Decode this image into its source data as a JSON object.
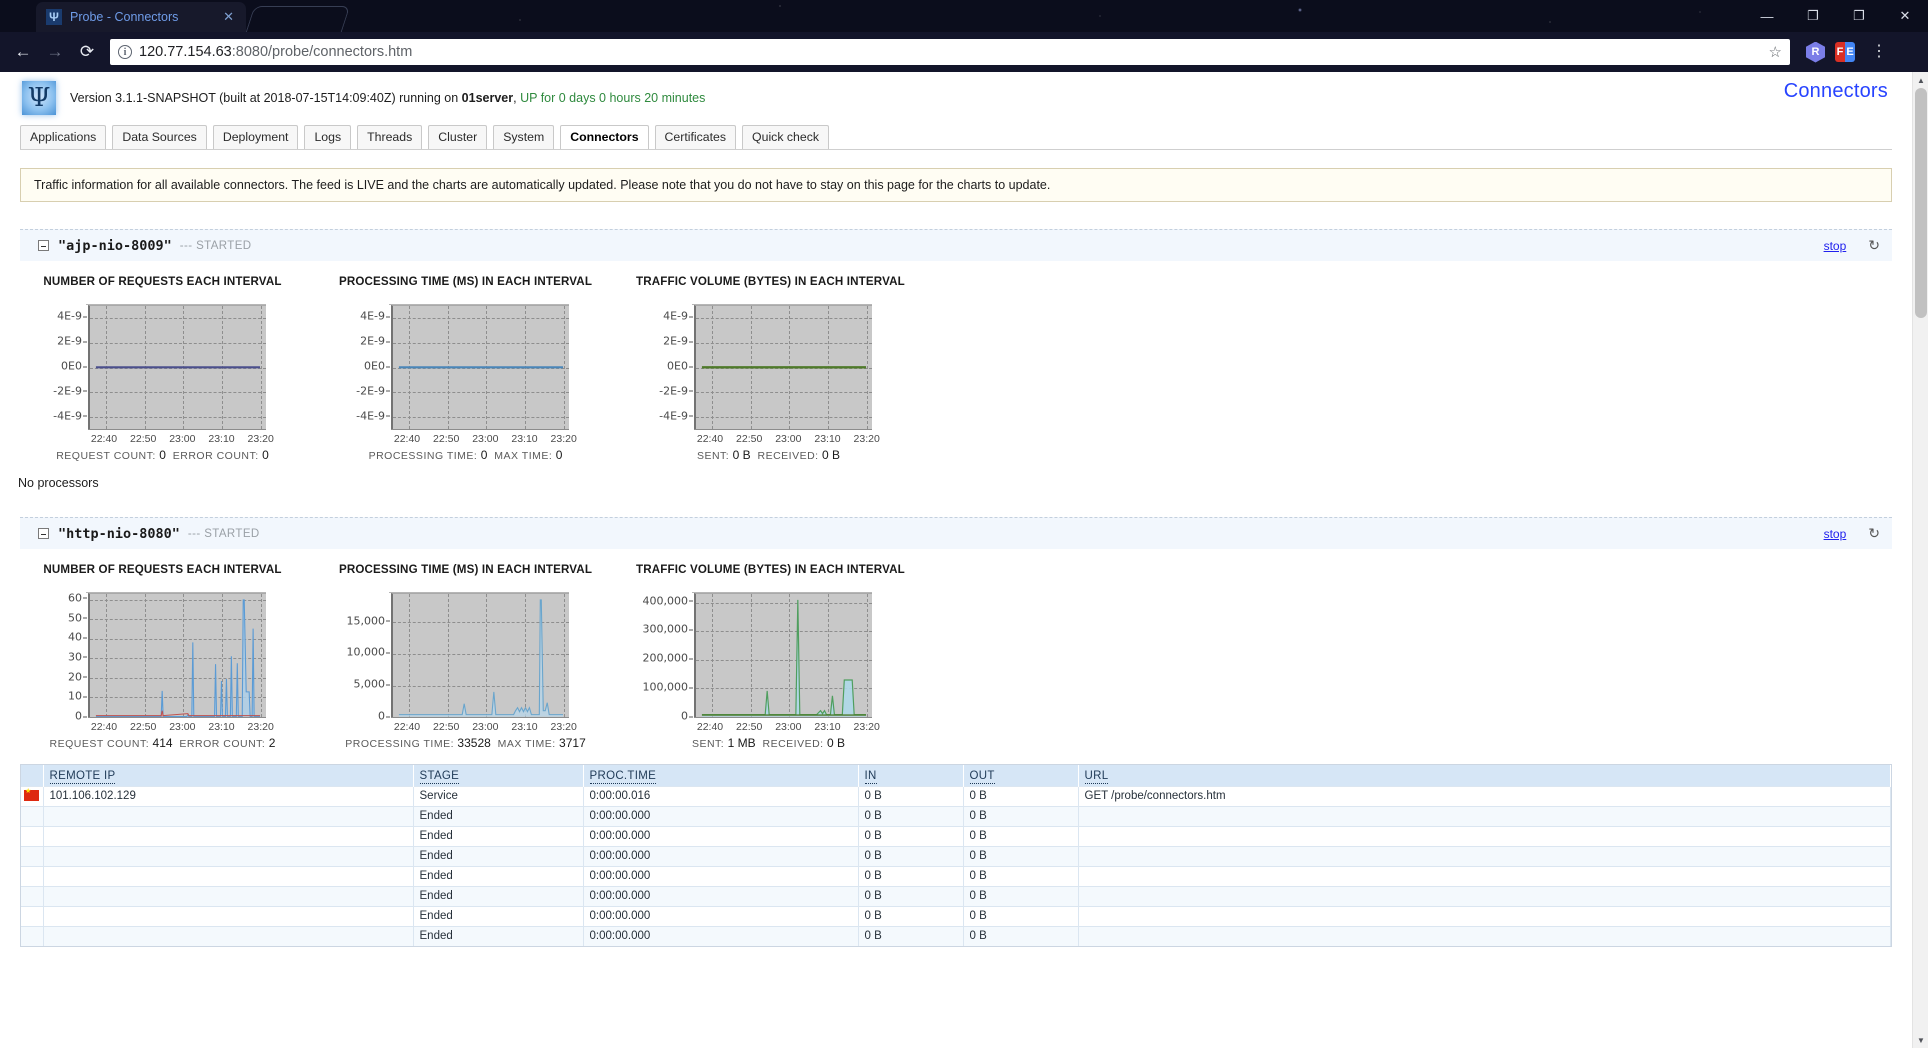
{
  "browser": {
    "tab_title": "Probe - Connectors",
    "favicon_glyph": "Ψ",
    "close_glyph": "✕",
    "back_glyph": "←",
    "forward_glyph": "→",
    "reload_glyph": "⟳",
    "url_host": "120.77.154.63",
    "url_rest": ":8080/probe/connectors.htm",
    "star_glyph": "☆",
    "ext_r_label": "R",
    "ext_fe_f": "F",
    "ext_fe_e": "E",
    "kebab_glyph": "⋮",
    "win_minimize": "—",
    "win_restore": "❐",
    "win_maximize": "❐",
    "win_close": "✕"
  },
  "app": {
    "logo_glyph": "Ψ",
    "version_prefix": "Version 3.1.1-SNAPSHOT (built at 2018-07-15T14:09:40Z) running on ",
    "host": "01server",
    "version_comma": ",",
    "uptime": " UP for 0 days 0 hours 20 minutes",
    "page_title": "Connectors"
  },
  "tabs": [
    {
      "label": "Applications",
      "active": false
    },
    {
      "label": "Data Sources",
      "active": false
    },
    {
      "label": "Deployment",
      "active": false
    },
    {
      "label": "Logs",
      "active": false
    },
    {
      "label": "Threads",
      "active": false
    },
    {
      "label": "Cluster",
      "active": false
    },
    {
      "label": "System",
      "active": false
    },
    {
      "label": "Connectors",
      "active": true
    },
    {
      "label": "Certificates",
      "active": false
    },
    {
      "label": "Quick check",
      "active": false
    }
  ],
  "banner": {
    "text": "Traffic information for all available connectors. The feed is LIVE and the charts are automatically updated. Please note that you do not have to stay on this page for the charts to update."
  },
  "connectors": [
    {
      "name": "\"ajp-nio-8009\"",
      "state": "--- STARTED",
      "stop_label": "stop",
      "refresh_glyph": "↻",
      "processors_note": "No processors",
      "charts": [
        {
          "title": "NUMBER OF REQUESTS EACH INTERVAL",
          "foot_label_1": "REQUEST COUNT:",
          "foot_value_1": "0",
          "foot_label_2": "ERROR COUNT:",
          "foot_value_2": "0"
        },
        {
          "title": "PROCESSING TIME (MS) IN EACH INTERVAL",
          "foot_label_1": "PROCESSING TIME:",
          "foot_value_1": "0",
          "foot_label_2": "MAX TIME:",
          "foot_value_2": "0"
        },
        {
          "title": "TRAFFIC VOLUME (BYTES) IN EACH INTERVAL",
          "foot_label_1": "SENT:",
          "foot_value_1": "0 B",
          "foot_label_2": "RECEIVED:",
          "foot_value_2": "0 B"
        }
      ]
    },
    {
      "name": "\"http-nio-8080\"",
      "state": "--- STARTED",
      "stop_label": "stop",
      "refresh_glyph": "↻",
      "charts": [
        {
          "title": "NUMBER OF REQUESTS EACH INTERVAL",
          "foot_label_1": "REQUEST COUNT:",
          "foot_value_1": "414",
          "foot_label_2": "ERROR COUNT:",
          "foot_value_2": "2"
        },
        {
          "title": "PROCESSING TIME (MS) IN EACH INTERVAL",
          "foot_label_1": "PROCESSING TIME:",
          "foot_value_1": "33528",
          "foot_label_2": "MAX TIME:",
          "foot_value_2": "3717"
        },
        {
          "title": "TRAFFIC VOLUME (BYTES) IN EACH INTERVAL",
          "foot_label_1": "SENT:",
          "foot_value_1": "1 MB",
          "foot_label_2": "RECEIVED:",
          "foot_value_2": "0 B"
        }
      ]
    }
  ],
  "chart_data": [
    {
      "id": "ajp-requests",
      "type": "line",
      "title": "NUMBER OF REQUESTS EACH INTERVAL",
      "xlabel": "",
      "ylabel": "",
      "grid": true,
      "legend": "none",
      "x_ticks": [
        "22:40",
        "22:50",
        "23:00",
        "23:10",
        "23:20"
      ],
      "y_ticks": [
        "4E-9",
        "2E-9",
        "0E0",
        "-2E-9",
        "-4E-9"
      ],
      "ylim": [
        -5e-09,
        5e-09
      ],
      "series": [
        {
          "name": "requests",
          "color": "#4b4f8c",
          "values": [
            0,
            0,
            0,
            0,
            0,
            0,
            0,
            0,
            0,
            0,
            0,
            0,
            0,
            0,
            0,
            0,
            0,
            0,
            0,
            0,
            0,
            0,
            0,
            0,
            0,
            0,
            0,
            0,
            0,
            0,
            0,
            0,
            0,
            0,
            0,
            0,
            0,
            0,
            0,
            0
          ]
        }
      ]
    },
    {
      "id": "ajp-processing",
      "type": "line",
      "title": "PROCESSING TIME (MS) IN EACH INTERVAL",
      "grid": true,
      "legend": "none",
      "x_ticks": [
        "22:40",
        "22:50",
        "23:00",
        "23:10",
        "23:20"
      ],
      "y_ticks": [
        "4E-9",
        "2E-9",
        "0E0",
        "-2E-9",
        "-4E-9"
      ],
      "ylim": [
        -5e-09,
        5e-09
      ],
      "series": [
        {
          "name": "processing time",
          "color": "#4a86b8",
          "values": [
            0,
            0,
            0,
            0,
            0,
            0,
            0,
            0,
            0,
            0,
            0,
            0,
            0,
            0,
            0,
            0,
            0,
            0,
            0,
            0,
            0,
            0,
            0,
            0,
            0,
            0,
            0,
            0,
            0,
            0,
            0,
            0,
            0,
            0,
            0,
            0,
            0,
            0,
            0,
            0
          ]
        }
      ]
    },
    {
      "id": "ajp-traffic",
      "type": "line",
      "title": "TRAFFIC VOLUME (BYTES) IN EACH INTERVAL",
      "grid": true,
      "legend": "none",
      "x_ticks": [
        "22:40",
        "22:50",
        "23:00",
        "23:10",
        "23:20"
      ],
      "y_ticks": [
        "4E-9",
        "2E-9",
        "0E0",
        "-2E-9",
        "-4E-9"
      ],
      "ylim": [
        -5e-09,
        5e-09
      ],
      "series": [
        {
          "name": "sent",
          "color": "#4f7a2a",
          "values": [
            0,
            0,
            0,
            0,
            0,
            0,
            0,
            0,
            0,
            0,
            0,
            0,
            0,
            0,
            0,
            0,
            0,
            0,
            0,
            0,
            0,
            0,
            0,
            0,
            0,
            0,
            0,
            0,
            0,
            0,
            0,
            0,
            0,
            0,
            0,
            0,
            0,
            0,
            0,
            0
          ]
        }
      ]
    },
    {
      "id": "http-requests",
      "type": "area",
      "title": "NUMBER OF REQUESTS EACH INTERVAL",
      "grid": true,
      "legend": "none",
      "x_ticks": [
        "22:40",
        "22:50",
        "23:00",
        "23:10",
        "23:20"
      ],
      "y_ticks": [
        "60",
        "50",
        "40",
        "30",
        "20",
        "10",
        "0"
      ],
      "ylim": [
        0,
        63
      ],
      "series": [
        {
          "name": "request count",
          "color": "#5b9bd5",
          "fill": "#aecfe8",
          "values": [
            0,
            0,
            0,
            0,
            0,
            0,
            0,
            0,
            0,
            0,
            0,
            0,
            0,
            0,
            0,
            0,
            0,
            13,
            0,
            0,
            0,
            0,
            0,
            0,
            0,
            3,
            38,
            0,
            0,
            0,
            0,
            27,
            0,
            18,
            20,
            31,
            0,
            26,
            0,
            60,
            13,
            13,
            45,
            0
          ]
        },
        {
          "name": "error count",
          "color": "#c0504d",
          "fill": "#d99694",
          "values": [
            0,
            0,
            0,
            0,
            0,
            0,
            0,
            0,
            0,
            0,
            0,
            0,
            0,
            0,
            0,
            0,
            0,
            3,
            0,
            0,
            0,
            0,
            0,
            0,
            0,
            1,
            0,
            0,
            0,
            0,
            0,
            0,
            0,
            0,
            0,
            0,
            0,
            0,
            0,
            0,
            0,
            0,
            0,
            0
          ]
        }
      ]
    },
    {
      "id": "http-processing",
      "type": "area",
      "title": "PROCESSING TIME (MS) IN EACH INTERVAL",
      "grid": true,
      "legend": "none",
      "x_ticks": [
        "22:40",
        "22:50",
        "23:00",
        "23:10",
        "23:20"
      ],
      "y_ticks": [
        "15,000",
        "10,000",
        "5,000",
        "0"
      ],
      "ylim": [
        0,
        19500
      ],
      "series": [
        {
          "name": "processing time",
          "color": "#6aa5cc",
          "fill": "#b9d6e8",
          "values": [
            0,
            0,
            0,
            0,
            0,
            0,
            0,
            0,
            0,
            0,
            0,
            0,
            0,
            0,
            0,
            0,
            0,
            2000,
            0,
            0,
            0,
            0,
            0,
            0,
            0,
            4000,
            200,
            0,
            0,
            600,
            900,
            700,
            1000,
            600,
            1100,
            600,
            200,
            200,
            18500,
            800,
            600,
            1500,
            300,
            0
          ]
        }
      ]
    },
    {
      "id": "http-traffic",
      "type": "area",
      "title": "TRAFFIC VOLUME (BYTES) IN EACH INTERVAL",
      "grid": true,
      "legend": "none",
      "x_ticks": [
        "22:40",
        "22:50",
        "23:00",
        "23:10",
        "23:20"
      ],
      "y_ticks": [
        "400,000",
        "300,000",
        "200,000",
        "100,000",
        "0"
      ],
      "ylim": [
        0,
        430000
      ],
      "series": [
        {
          "name": "sent",
          "color": "#4f9e5e",
          "fill": "#aed8e8",
          "values": [
            0,
            0,
            0,
            0,
            0,
            0,
            0,
            0,
            0,
            0,
            0,
            0,
            0,
            0,
            0,
            0,
            0,
            83000,
            0,
            0,
            0,
            0,
            0,
            0,
            0,
            403000,
            0,
            0,
            0,
            0,
            9000,
            12000,
            5000,
            8000,
            67000,
            3000,
            2000,
            3000,
            120000,
            122000,
            122000,
            118000,
            0,
            0
          ]
        },
        {
          "name": "received",
          "color": "#4f7a2a",
          "fill": "none",
          "values": [
            0,
            0,
            0,
            0,
            0,
            0,
            0,
            0,
            0,
            0,
            0,
            0,
            0,
            0,
            0,
            0,
            0,
            0,
            0,
            0,
            0,
            0,
            0,
            0,
            0,
            0,
            0,
            0,
            0,
            0,
            0,
            0,
            0,
            0,
            0,
            0,
            0,
            0,
            0,
            0,
            0,
            0,
            0,
            0
          ]
        }
      ]
    }
  ],
  "request_table": {
    "columns": [
      "REMOTE IP",
      "STAGE",
      "PROC.TIME",
      "IN",
      "OUT",
      "URL"
    ],
    "rows": [
      {
        "flag": "cn",
        "remote_ip": "101.106.102.129",
        "stage": "Service",
        "proc_time": "0:00:00.016",
        "in": "0 B",
        "out": "0 B",
        "url": "GET /probe/connectors.htm"
      },
      {
        "flag": "",
        "remote_ip": "",
        "stage": "Ended",
        "proc_time": "0:00:00.000",
        "in": "0 B",
        "out": "0 B",
        "url": ""
      },
      {
        "flag": "",
        "remote_ip": "",
        "stage": "Ended",
        "proc_time": "0:00:00.000",
        "in": "0 B",
        "out": "0 B",
        "url": ""
      },
      {
        "flag": "",
        "remote_ip": "",
        "stage": "Ended",
        "proc_time": "0:00:00.000",
        "in": "0 B",
        "out": "0 B",
        "url": ""
      },
      {
        "flag": "",
        "remote_ip": "",
        "stage": "Ended",
        "proc_time": "0:00:00.000",
        "in": "0 B",
        "out": "0 B",
        "url": ""
      },
      {
        "flag": "",
        "remote_ip": "",
        "stage": "Ended",
        "proc_time": "0:00:00.000",
        "in": "0 B",
        "out": "0 B",
        "url": ""
      },
      {
        "flag": "",
        "remote_ip": "",
        "stage": "Ended",
        "proc_time": "0:00:00.000",
        "in": "0 B",
        "out": "0 B",
        "url": ""
      },
      {
        "flag": "",
        "remote_ip": "",
        "stage": "Ended",
        "proc_time": "0:00:00.000",
        "in": "0 B",
        "out": "0 B",
        "url": ""
      }
    ]
  },
  "scrollbar": {
    "up_glyph": "▲",
    "down_glyph": "▼"
  },
  "colors": {
    "accent_link": "#2743ff",
    "uptime_green": "#2f8a3e",
    "banner_bg": "#fffdf3",
    "table_header_bg": "#d6e6f6",
    "plot_bg": "#c8c8c8"
  }
}
